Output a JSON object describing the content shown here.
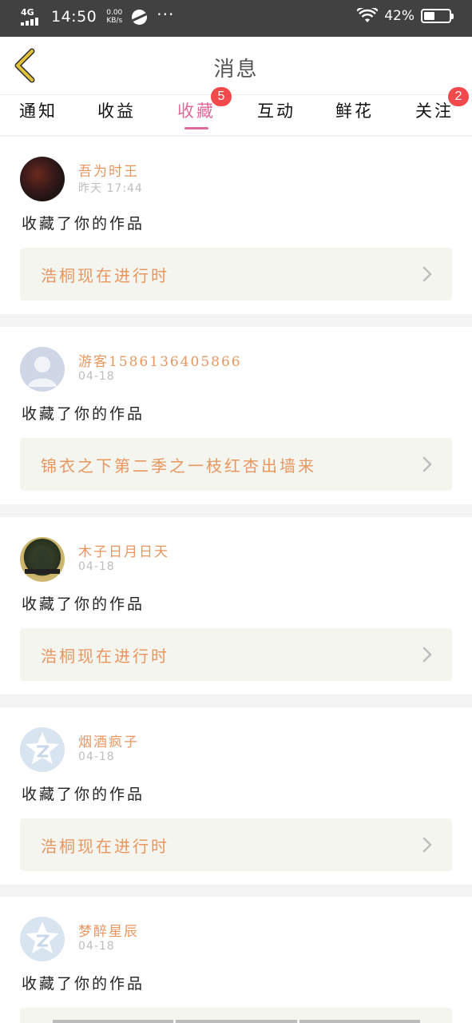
{
  "status_bar": {
    "network": "4G",
    "time": "14:50",
    "speed_value": "0.00",
    "speed_unit": "KB/s",
    "more": "···",
    "battery_pct": "42%",
    "battery_level": 0.42
  },
  "header": {
    "title": "消息"
  },
  "tabs": [
    {
      "label": "通知",
      "badge": ""
    },
    {
      "label": "收益",
      "badge": ""
    },
    {
      "label": "收藏",
      "badge": "5",
      "active": true
    },
    {
      "label": "互动",
      "badge": ""
    },
    {
      "label": "鲜花",
      "badge": ""
    },
    {
      "label": "关注",
      "badge": "2"
    }
  ],
  "messages": [
    {
      "user": "吾为时王",
      "date": "昨天 17:44",
      "action": "收藏了你的作品",
      "work": "浩桐现在进行时",
      "avatar_icon": "user-photo-avatar"
    },
    {
      "user": "游客1586136405866",
      "date": "04-18",
      "action": "收藏了你的作品",
      "work": "锦衣之下第二季之一枝红杏出墙来",
      "avatar_icon": "default-person-avatar"
    },
    {
      "user": "木子日月日天",
      "date": "04-18",
      "action": "收藏了你的作品",
      "work": "浩桐现在进行时",
      "avatar_icon": "user-photo-avatar"
    },
    {
      "user": "烟酒疯子",
      "date": "04-18",
      "action": "收藏了你的作品",
      "work": "浩桐现在进行时",
      "avatar_icon": "qq-avatar"
    },
    {
      "user": "梦醉星辰",
      "date": "04-18",
      "action": "收藏了你的作品",
      "work": "",
      "avatar_icon": "qq-avatar"
    }
  ],
  "colors": {
    "accent": "#e0699c",
    "name": "#e89660",
    "badge": "#f2494c",
    "back_arrow": "#e3c23a"
  }
}
